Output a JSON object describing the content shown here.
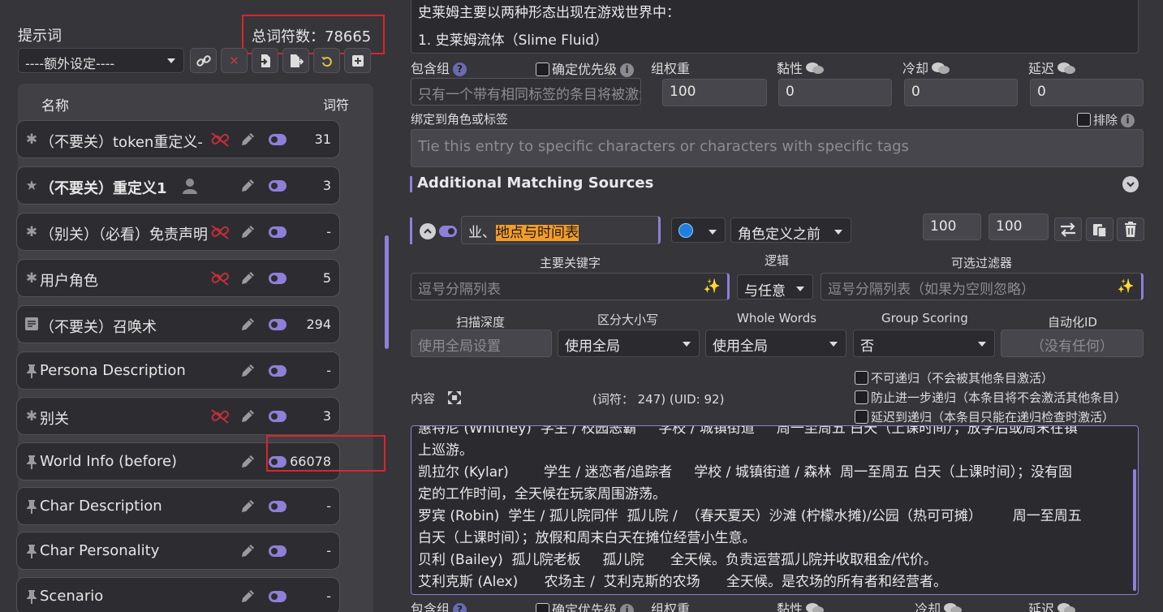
{
  "left": {
    "title": "提示词",
    "total_label": "总词符数：",
    "total_value": "78665",
    "extra_select": "----额外设定----",
    "columns": {
      "name": "名称",
      "tokens": "词符"
    },
    "rows": [
      {
        "name": "（不要关）token重定义-",
        "tokens": "31",
        "icon": "asterisk-icon",
        "unlinked": true
      },
      {
        "name": "（不要关）重定义1",
        "tokens": "3",
        "icon": "star-icon",
        "unlinked": false
      },
      {
        "name": "（别关）（必看）免责声明",
        "tokens": "-",
        "icon": "asterisk-icon",
        "unlinked": true
      },
      {
        "name": "用户角色",
        "tokens": "5",
        "icon": "asterisk-icon",
        "unlinked": true
      },
      {
        "name": "（不要关）召唤术",
        "tokens": "294",
        "icon": "note-icon",
        "unlinked": false
      },
      {
        "name": "Persona Description",
        "tokens": "-",
        "icon": "pin-icon",
        "unlinked": false
      },
      {
        "name": "别关",
        "tokens": "3",
        "icon": "asterisk-icon",
        "unlinked": true
      },
      {
        "name": "World Info (before)",
        "tokens": "66078",
        "icon": "pin-icon",
        "unlinked": false
      },
      {
        "name": "Char Description",
        "tokens": "-",
        "icon": "pin-icon",
        "unlinked": false
      },
      {
        "name": "Char Personality",
        "tokens": "-",
        "icon": "pin-icon",
        "unlinked": false
      },
      {
        "name": "Scenario",
        "tokens": "-",
        "icon": "pin-icon",
        "unlinked": false
      }
    ]
  },
  "right": {
    "top_text_line1": "史莱姆主要以两种形态出现在游戏世界中：",
    "top_text_line2": "1. 史莱姆流体（Slime Fluid）",
    "inclusion_group_label": "包含组",
    "prioritize_label": "确定优先级",
    "group_weight_label": "组权重",
    "sticky_label": "黏性",
    "cooldown_label": "冷却",
    "delay_label": "延迟",
    "inclusion_placeholder": "只有一个带有相同标签的条目将被激活",
    "group_weight_value": "100",
    "sticky_value": "0",
    "cooldown_value": "0",
    "delay_value": "0",
    "bind_label": "绑定到角色或标签",
    "exclude_label": "排除",
    "bind_placeholder": "Tie this entry to specific characters or characters with specific tags",
    "ams_title": "Additional Matching Sources",
    "entry_title_prefix": "业、",
    "entry_title_highlight": "地点与时间表",
    "position_select": "角色定义之前",
    "order_value": "100",
    "probability_value": "100",
    "primary_keys_label": "主要关键字",
    "logic_label": "逻辑",
    "optional_filter_label": "可选过滤器",
    "primary_keys_placeholder": "逗号分隔列表",
    "logic_select": "与任意",
    "optional_filter_placeholder": "逗号分隔列表（如果为空则忽略）",
    "scan_depth_label": "扫描深度",
    "case_label": "区分大小写",
    "whole_words_label": "Whole Words",
    "group_scoring_label": "Group Scoring",
    "automation_label": "自动化ID",
    "scan_depth_placeholder": "使用全局设置",
    "case_select": "使用全局",
    "whole_words_select": "使用全局",
    "group_scoring_select": "否",
    "automation_placeholder": "（没有任何）",
    "content_label": "内容",
    "content_tokens": "(词符：  247)  (UID: 92)",
    "no_recursion": "不可递归（不会被其他条目激活）",
    "prevent_recursion": "防止进一步递归（本条目将不会激活其他条目）",
    "delay_recursion": "延迟到递归（本条目只能在递归检查时激活）",
    "content_lines": [
      "惠特尼 (Whitney)  学生 / 校园恶霸     学校 / 城镇街道     周一至周五 白天（上课时间）；放学后或周末在镇",
      "上巡游。",
      "凯拉尔 (Kylar)        学生 / 迷恋者/追踪者     学校 / 城镇街道 / 森林  周一至周五 白天（上课时间）；没有固",
      "定的工作时间，全天候在玩家周围游荡。",
      "罗宾 (Robin)  学生 / 孤儿院同伴  孤儿院 /  （春天夏天）沙滩 (柠檬水摊)/公园（热可可摊）       周一至周五",
      "白天（上课时间）；放假和周末白天在摊位经营小生意。",
      "贝利 (Bailey)  孤儿院老板     孤儿院      全天候。负责运营孤儿院并收取租金/代价。",
      "艾利克斯 (Alex)      农场主 /  艾利克斯的农场      全天候。是农场的所有者和经营者。"
    ]
  }
}
